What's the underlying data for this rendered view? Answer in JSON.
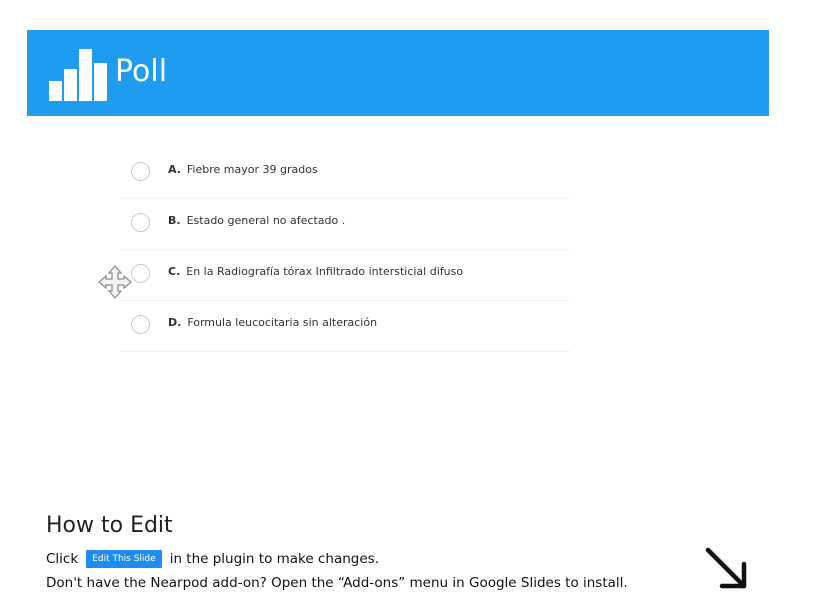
{
  "header": {
    "title": "Poll",
    "accent_color": "#1e9cef",
    "logo_icon": "bar-chart-icon"
  },
  "poll": {
    "options": [
      {
        "letter": "A.",
        "text": "Fiebre mayor 39 grados"
      },
      {
        "letter": "B.",
        "text": "Estado general no afectado  ."
      },
      {
        "letter": "C.",
        "text": "En la Radiografía tórax Infiltrado intersticial difuso"
      },
      {
        "letter": "D.",
        "text": "Formula leucocitaria sin alteración"
      }
    ]
  },
  "cursor": {
    "icon": "move-cursor-icon"
  },
  "how_to_edit": {
    "title": "How to Edit",
    "line1_prefix": "Click",
    "edit_button_label": "Edit This Slide",
    "line1_suffix": "in the plugin to make changes.",
    "line2": "Don't have the Nearpod add-on? Open the “Add-ons” menu in Google Slides to install."
  },
  "corner_arrow": {
    "icon": "arrow-down-right-icon"
  }
}
